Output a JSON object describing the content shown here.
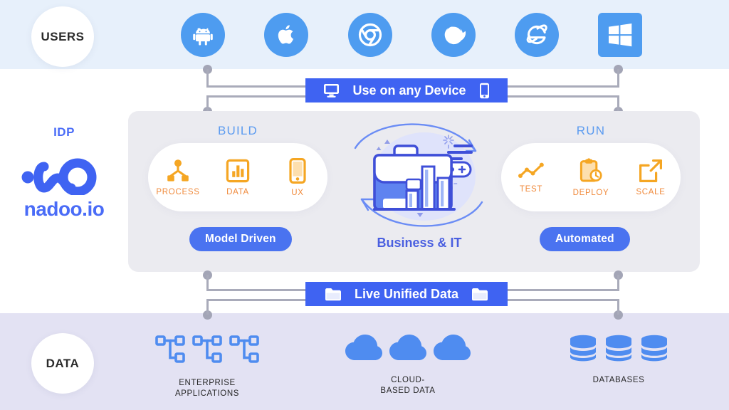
{
  "bands": {
    "top_label": "USERS",
    "bottom_label": "DATA",
    "top_color": "#e7f0fb",
    "bottom_color": "#e3e2f3"
  },
  "platforms": [
    {
      "name": "android-icon",
      "label": "Android"
    },
    {
      "name": "apple-icon",
      "label": "Apple"
    },
    {
      "name": "chrome-icon",
      "label": "Chrome"
    },
    {
      "name": "firefox-icon",
      "label": "Firefox"
    },
    {
      "name": "internet-explorer-icon",
      "label": "Internet Explorer"
    },
    {
      "name": "windows-icon",
      "label": "Windows"
    }
  ],
  "idp": {
    "label": "IDP",
    "wordmark": "nadoo.io",
    "brand_color": "#4a6cf7"
  },
  "device_bar": {
    "text": "Use on any Device",
    "left_icon": "desktop-monitor-icon",
    "right_icon": "smartphone-icon",
    "color": "#3f63f2"
  },
  "unified_bar": {
    "text": "Live Unified Data",
    "left_icon": "folder-icon",
    "right_icon": "folder-icon",
    "color": "#3f63f2"
  },
  "panel": {
    "background": "#ebebf0",
    "build": {
      "title": "BUILD",
      "tag": "Model Driven",
      "items": [
        {
          "label": "PROCESS",
          "icon": "process-hierarchy-icon"
        },
        {
          "label": "DATA",
          "icon": "bar-chart-icon"
        },
        {
          "label": "UX",
          "icon": "mobile-phone-icon"
        }
      ]
    },
    "run": {
      "title": "RUN",
      "tag": "Automated",
      "items": [
        {
          "label": "TEST",
          "icon": "line-chart-icon"
        },
        {
          "label": "DEPLOY",
          "icon": "clipboard-clock-icon"
        },
        {
          "label": "SCALE",
          "icon": "external-link-arrow-icon"
        }
      ]
    },
    "center": {
      "label": "Business & IT",
      "icon": "briefcase-bar-chart-icon",
      "cycle_icon": "circular-arrows-icon"
    },
    "accent_orange": "#f5a623",
    "accent_blue": "#4a73f0",
    "title_color": "#5b9bf0"
  },
  "data_sources": [
    {
      "label": "ENTERPRISE\nAPPLICATIONS",
      "line1": "ENTERPRISE",
      "line2": "APPLICATIONS",
      "icon": "sitemap-network-icon",
      "count": 3
    },
    {
      "label": "CLOUD-\nBASED DATA",
      "line1": "CLOUD-",
      "line2": "BASED DATA",
      "icon": "cloud-icon",
      "count": 3
    },
    {
      "label": "DATABASES",
      "line1": "DATABASES",
      "line2": "",
      "icon": "database-cylinder-icon",
      "count": 3
    }
  ]
}
